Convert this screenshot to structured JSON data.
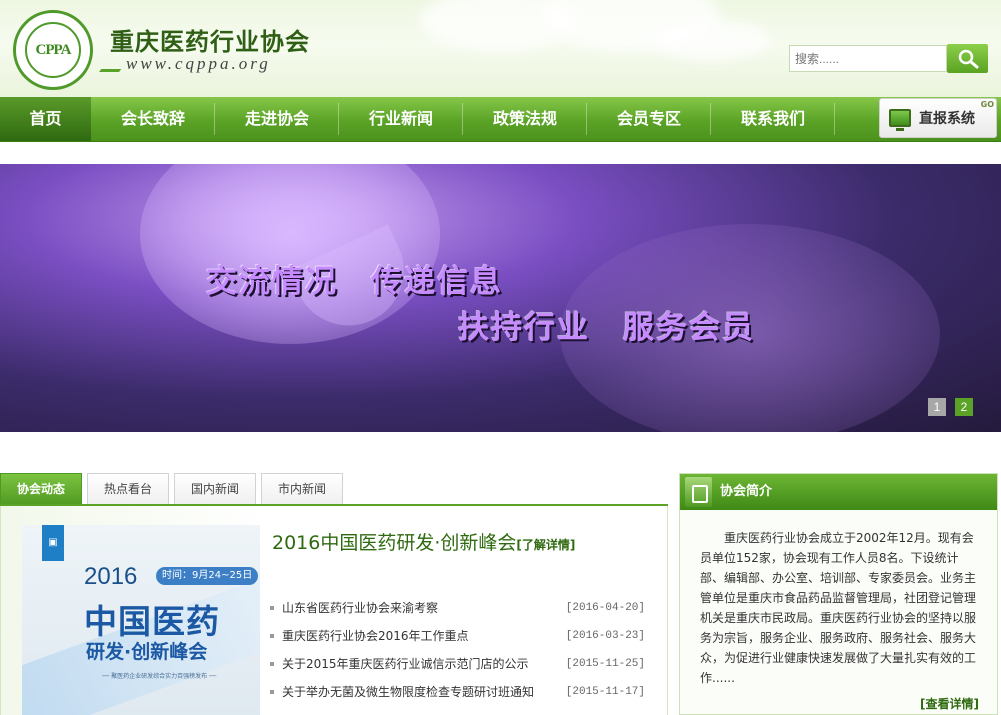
{
  "header": {
    "logo_text": "CPPA",
    "site_name": "重庆医药行业协会",
    "site_url": "www.cqppa.org",
    "search_placeholder": "搜索......"
  },
  "nav": {
    "items": [
      {
        "label": "首页",
        "active": true
      },
      {
        "label": "会长致辞"
      },
      {
        "label": "走进协会"
      },
      {
        "label": "行业新闻"
      },
      {
        "label": "政策法规"
      },
      {
        "label": "会员专区"
      },
      {
        "label": "联系我们"
      }
    ],
    "direct_label": "直报系统",
    "direct_badge": "GO"
  },
  "banner": {
    "slogan_line1": "交流情况　传递信息",
    "slogan_line2": "扶持行业　服务会员",
    "pages": [
      "1",
      "2"
    ],
    "active_page": "2"
  },
  "tabs": [
    "协会动态",
    "热点看台",
    "国内新闻",
    "市内新闻"
  ],
  "promo": {
    "year": "2016",
    "date": "时间：9月24~25日",
    "title_big": "中国医药",
    "title_sub": "研发·创新峰会",
    "tiny": "── 聚医药企业研发综合实力百强榜发布 ──"
  },
  "headline": {
    "title": "2016中国医药研发·创新峰会",
    "more": "[了解详情]"
  },
  "news": [
    {
      "title": "山东省医药行业协会来渝考察",
      "date": "[2016-04-20]"
    },
    {
      "title": "重庆医药行业协会2016年工作重点",
      "date": "[2016-03-23]"
    },
    {
      "title": "关于2015年重庆医药行业诚信示范门店的公示",
      "date": "[2015-11-25]"
    },
    {
      "title": "关于举办无菌及微生物限度检查专题研讨班通知",
      "date": "[2015-11-17]"
    }
  ],
  "intro": {
    "title": "协会简介",
    "body": "重庆医药行业协会成立于2002年12月。现有会员单位152家，协会现有工作人员8名。下设统计部、编辑部、办公室、培训部、专家委员会。业务主管单位是重庆市食品药品监督管理局，社团登记管理机关是重庆市民政局。重庆医药行业协会的坚持以服务为宗旨，服务企业、服务政府、服务社会、服务大众，为促进行业健康快速发展做了大量扎实有效的工作......",
    "more": "[查看详情]"
  },
  "colors": {
    "brand_green": "#5aa326",
    "dark_green": "#2f6a10",
    "banner_purple": "#7a4ec2"
  }
}
